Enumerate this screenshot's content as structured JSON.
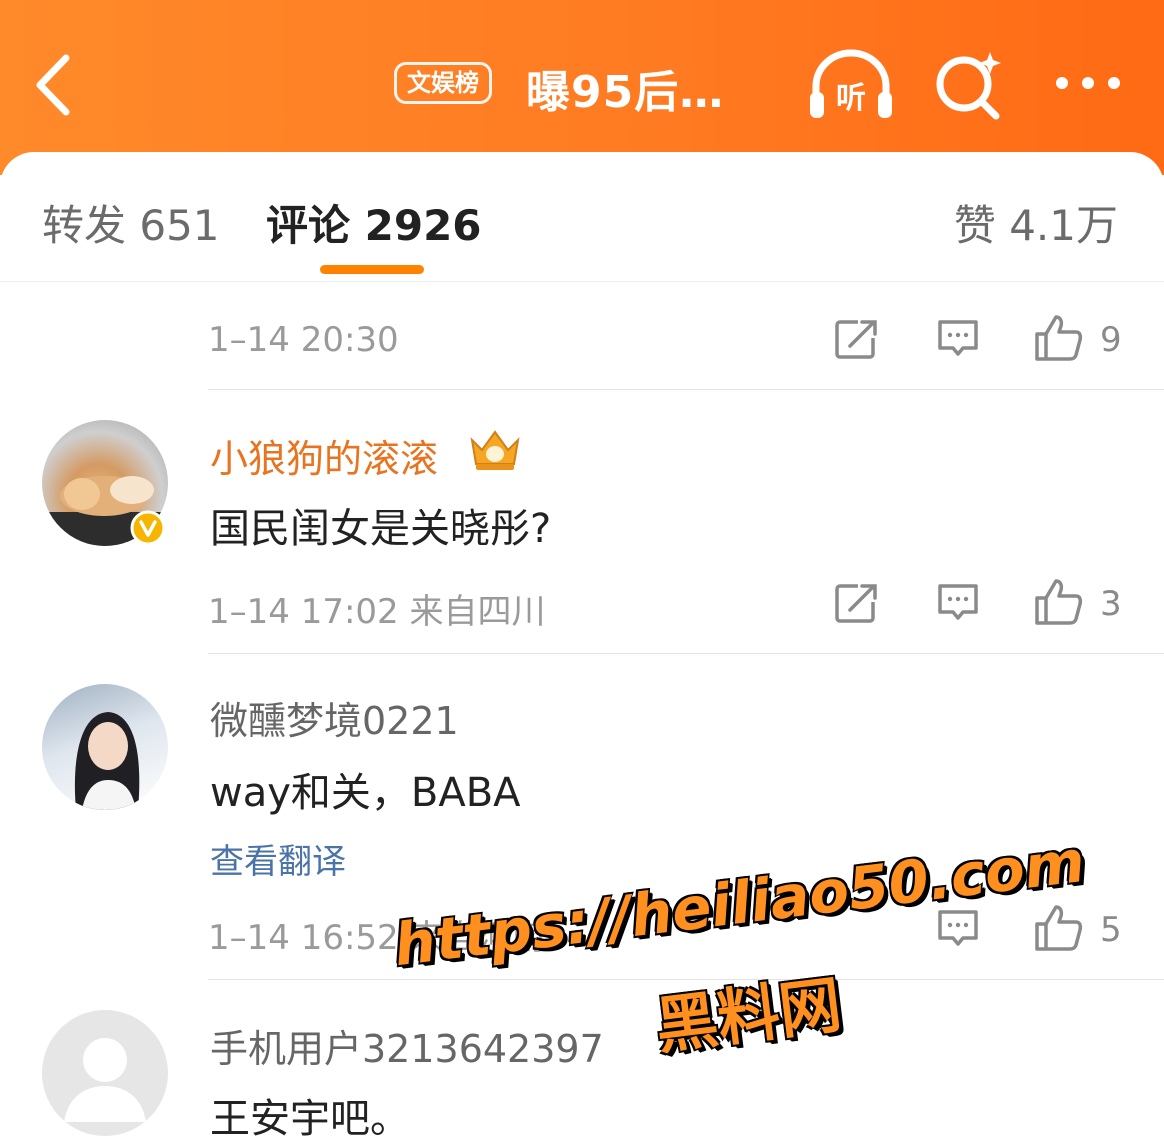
{
  "header": {
    "topic_tag": "文娱榜",
    "title": "曝95后…",
    "colors": {
      "gradient_start": "#ff8a2a",
      "gradient_end": "#ff6a14"
    }
  },
  "tabs": {
    "repost": "转发 651",
    "comment": "评论 2926",
    "like": "赞 4.1万",
    "accent": "#ff8200"
  },
  "comments": [
    {
      "time": "1–14 20:30",
      "likes": "9"
    },
    {
      "username": "小狼狗的滚滚",
      "text": "国民闺女是关晓彤?",
      "time": "1–14 17:02  来自四川",
      "likes": "3"
    },
    {
      "username": "微醺梦境0221",
      "text": "way和关，BABA",
      "translate": "查看翻译",
      "time": "1–14 16:52  来自河南",
      "likes": "5"
    },
    {
      "username": "手机用户3213642397",
      "text": "王安宇吧。"
    }
  ],
  "watermark": {
    "url": "https://heiliao50.com",
    "name": "黑料网"
  }
}
